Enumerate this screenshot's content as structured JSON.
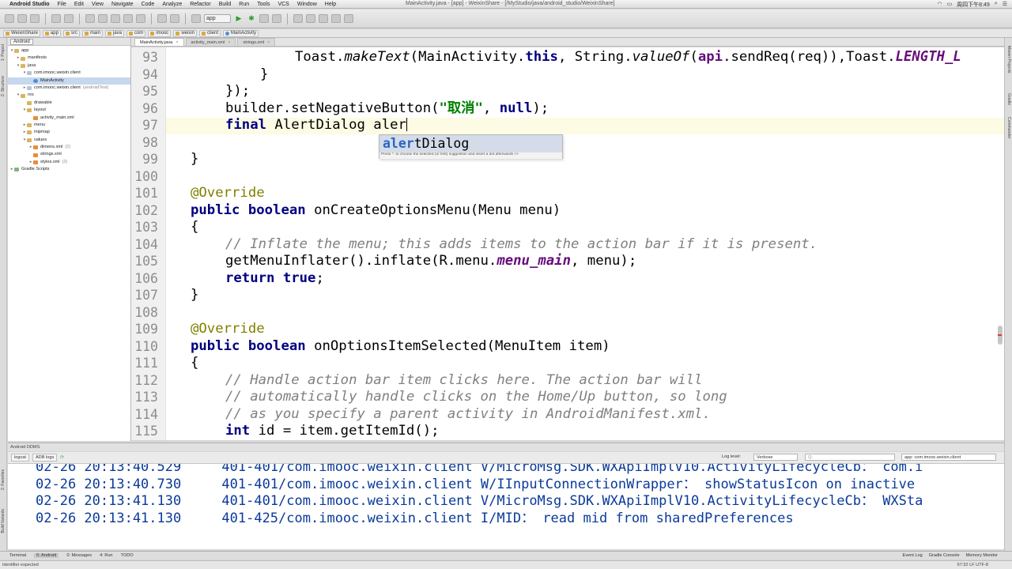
{
  "menubar": {
    "app_name": "Android Studio",
    "items": [
      "File",
      "Edit",
      "View",
      "Navigate",
      "Code",
      "Analyze",
      "Refactor",
      "Build",
      "Run",
      "Tools",
      "VCS",
      "Window",
      "Help"
    ],
    "window_title": "MainActivity.java - [app] - WeixinShare - [/MyStudio/java/android_studio/WeixinShare]",
    "clock": "周四下午8:49"
  },
  "toolbar": {
    "config_selector": "app"
  },
  "breadcrumb": [
    "WeixinShare",
    "app",
    "src",
    "main",
    "java",
    "com",
    "imooc",
    "weixin",
    "client",
    "MainActivity"
  ],
  "project_panel": {
    "view_selector": "Android",
    "tree": [
      {
        "label": "app",
        "indent": 0,
        "icon": "folder",
        "arrow": "▾"
      },
      {
        "label": "manifests",
        "indent": 1,
        "icon": "folder",
        "arrow": "▸"
      },
      {
        "label": "java",
        "indent": 1,
        "icon": "folder",
        "arrow": "▾"
      },
      {
        "label": "com.imooc.weixin.client",
        "indent": 2,
        "icon": "pkg",
        "arrow": "▾"
      },
      {
        "label": "MainActivity",
        "indent": 3,
        "icon": "cls",
        "arrow": "",
        "selected": true
      },
      {
        "label": "com.imooc.weixin.client",
        "suffix": "(androidTest)",
        "indent": 2,
        "icon": "pkg",
        "arrow": "▸"
      },
      {
        "label": "res",
        "indent": 1,
        "icon": "folder",
        "arrow": "▾"
      },
      {
        "label": "drawable",
        "indent": 2,
        "icon": "folder",
        "arrow": ""
      },
      {
        "label": "layout",
        "indent": 2,
        "icon": "folder",
        "arrow": "▾"
      },
      {
        "label": "activity_main.xml",
        "indent": 3,
        "icon": "xml",
        "arrow": ""
      },
      {
        "label": "menu",
        "indent": 2,
        "icon": "folder",
        "arrow": "▸"
      },
      {
        "label": "mipmap",
        "indent": 2,
        "icon": "folder",
        "arrow": "▸"
      },
      {
        "label": "values",
        "indent": 2,
        "icon": "folder",
        "arrow": "▾"
      },
      {
        "label": "dimens.xml",
        "suffix": "(2)",
        "indent": 3,
        "icon": "xml",
        "arrow": "▸"
      },
      {
        "label": "strings.xml",
        "indent": 3,
        "icon": "xml",
        "arrow": ""
      },
      {
        "label": "styles.xml",
        "suffix": "(2)",
        "indent": 3,
        "icon": "xml",
        "arrow": "▸"
      },
      {
        "label": "Gradle Scripts",
        "indent": 0,
        "icon": "gradle",
        "arrow": "▸"
      }
    ]
  },
  "editor_tabs": [
    {
      "label": "MainActivity.java",
      "active": true
    },
    {
      "label": "activity_main.xml",
      "active": false
    },
    {
      "label": "strings.xml",
      "active": false
    }
  ],
  "editor": {
    "current_line": 97,
    "line_numbers": [
      "93",
      "94",
      "95",
      "96",
      "97",
      "98",
      "99",
      "100",
      "101",
      "102",
      "103",
      "104",
      "105",
      "106",
      "107",
      "108",
      "109",
      "110",
      "111",
      "112",
      "113",
      "114",
      "115"
    ]
  },
  "autocomplete": {
    "match": "aler",
    "rest": "tDialog",
    "hint": "Press ^. to choose the selected (or first) suggestion and insert a dot afterwards  >>"
  },
  "ddms": {
    "title": "Android DDMS",
    "tabs": [
      "logcat",
      "ADB logs"
    ],
    "log_level_label": "Log level:",
    "log_level": "Verbose",
    "search_placeholder": "Q-",
    "app_filter": "app: com.imooc.weixin.client",
    "lines": [
      "02-26 20:13:40.529     401-401/com.imooc.weixin.client V/MicroMsg.SDK.WXApiImplV10.ActivityLifecycleCb： com.i",
      "02-26 20:13:40.730     401-401/com.imooc.weixin.client W/IInputConnectionWrapper： showStatusIcon on inactive",
      "02-26 20:13:41.130     401-401/com.imooc.weixin.client V/MicroMsg.SDK.WXApiImplV10.ActivityLifecycleCb： WXSta",
      "02-26 20:13:41.130     401-425/com.imooc.weixin.client I/MID： read mid from sharedPreferences"
    ]
  },
  "bottom_tools": [
    "Terminal",
    "6: Android",
    "0: Messages",
    "4: Run",
    "TODO"
  ],
  "bottom_tools_right": [
    "Event Log",
    "Gradle Console",
    "Memory Monitor"
  ],
  "status": {
    "message": "Identifier expected",
    "position": "97:32  LF  UTF-8"
  },
  "colors": {
    "keyword": "#000080",
    "string": "#008000",
    "comment": "#808080",
    "annotation": "#808000",
    "field": "#660e7a",
    "logcat_text": "#0a3a9a",
    "caret_line": "#fdfbe4"
  }
}
